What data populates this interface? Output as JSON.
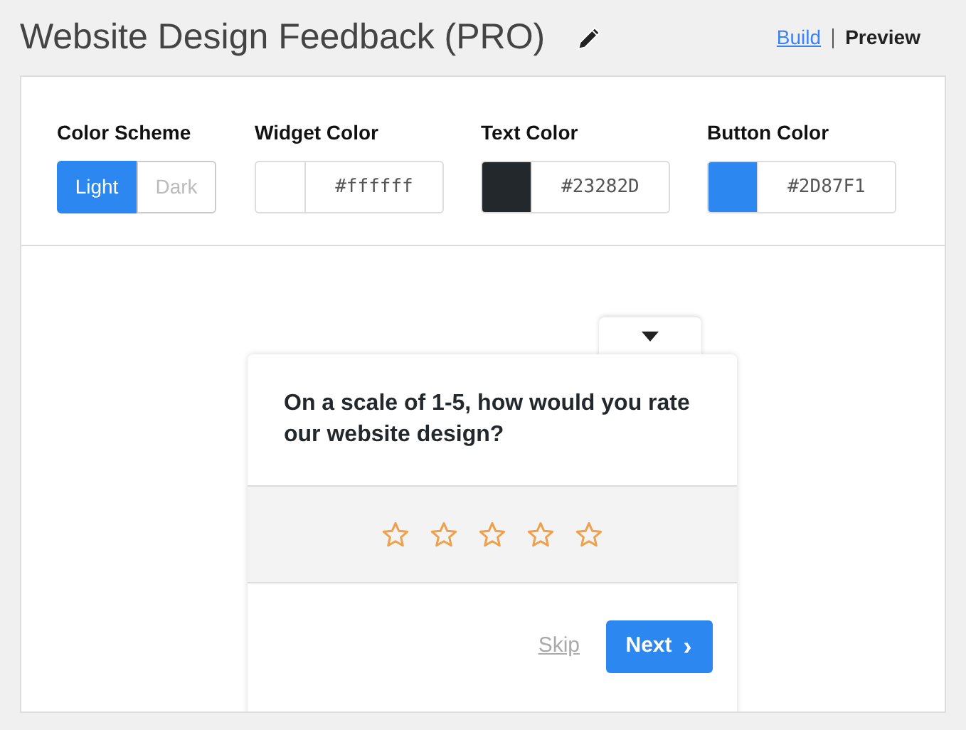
{
  "title": "Website Design Feedback (PRO)",
  "view_links": [
    {
      "label": "Build",
      "selected": false
    },
    {
      "label": "Preview",
      "selected": true
    }
  ],
  "color_scheme": {
    "label": "Color Scheme",
    "options": [
      {
        "label": "Light",
        "selected": true
      },
      {
        "label": "Dark",
        "selected": false
      }
    ]
  },
  "colors": [
    {
      "label": "Widget Color",
      "value": "#ffffff",
      "color": "#ffffff"
    },
    {
      "label": "Text Color",
      "value": "#23282D",
      "color": "#23282d"
    },
    {
      "label": "Button Color",
      "value": "#2D87F1",
      "color": "#2d87f1"
    }
  ],
  "widget": {
    "question": "On a scale of 1-5, how would you rate our website design?",
    "stars": 0,
    "skip": "Skip",
    "next": "Next",
    "next_icon": "›"
  }
}
